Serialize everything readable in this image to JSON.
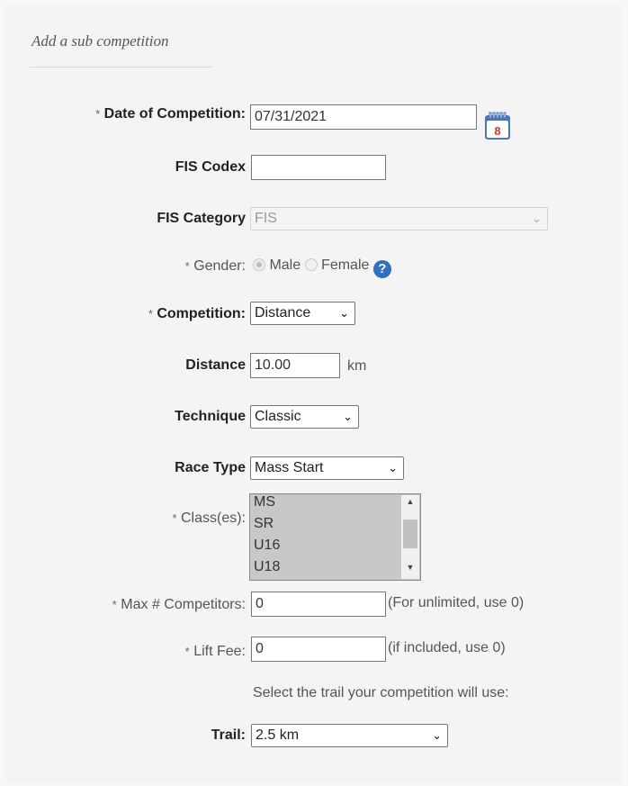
{
  "heading": "Add a sub competition",
  "required_marker": "*",
  "date": {
    "label": "Date of Competition:",
    "value": "07/31/2021",
    "calendar_day": "8"
  },
  "fis_codex": {
    "label": "FIS Codex",
    "value": ""
  },
  "fis_category": {
    "label": "FIS Category",
    "value": "FIS"
  },
  "gender": {
    "label": "Gender:",
    "options": [
      "Male",
      "Female"
    ],
    "selected": "Male",
    "help": "?"
  },
  "competition": {
    "label": "Competition:",
    "value": "Distance"
  },
  "distance": {
    "label": "Distance",
    "value": "10.00",
    "unit": "km"
  },
  "technique": {
    "label": "Technique",
    "value": "Classic"
  },
  "race_type": {
    "label": "Race Type",
    "value": "Mass Start"
  },
  "classes": {
    "label": "Class(es):",
    "options": [
      "MS",
      "SR",
      "U16",
      "U18"
    ]
  },
  "max_competitors": {
    "label": "Max # Competitors:",
    "value": "0",
    "hint": "(For unlimited, use 0)"
  },
  "lift_fee": {
    "label": "Lift Fee:",
    "value": "0",
    "hint": "(if included, use 0)"
  },
  "trail_prompt": "Select the trail your competition will use:",
  "trail": {
    "label": "Trail:",
    "value": "2.5 km"
  }
}
